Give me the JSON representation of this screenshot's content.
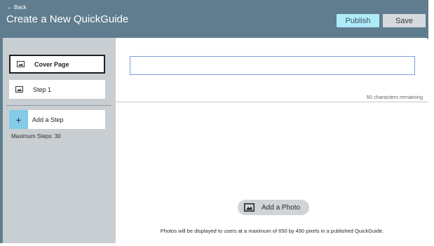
{
  "header": {
    "back_label": "Back",
    "title": "Create a New QuickGuide",
    "publish_label": "Publish",
    "save_label": "Save"
  },
  "sidebar": {
    "steps": [
      {
        "label": "Cover Page",
        "icon": "image-icon",
        "active": true
      },
      {
        "label": "Step 1",
        "icon": "image-icon",
        "active": false
      }
    ],
    "add_step_label": "Add a Step",
    "add_step_icon": "plus-icon",
    "max_steps": "Maximum Steps: 30"
  },
  "main": {
    "title_value": "",
    "chars_remaining": "50 characters remaining",
    "add_photo_label": "Add a Photo",
    "photo_note": "Photos will be displayed to users at a maximum of 650 by 490 pixels in a published QuickGuide."
  },
  "colors": {
    "header_bg": "#5f7d8e",
    "publish_bg": "#aeeaf8",
    "sidebar_bg": "#c8ced2",
    "add_step_accent": "#83cbe6",
    "input_border": "#7f9fd4"
  }
}
